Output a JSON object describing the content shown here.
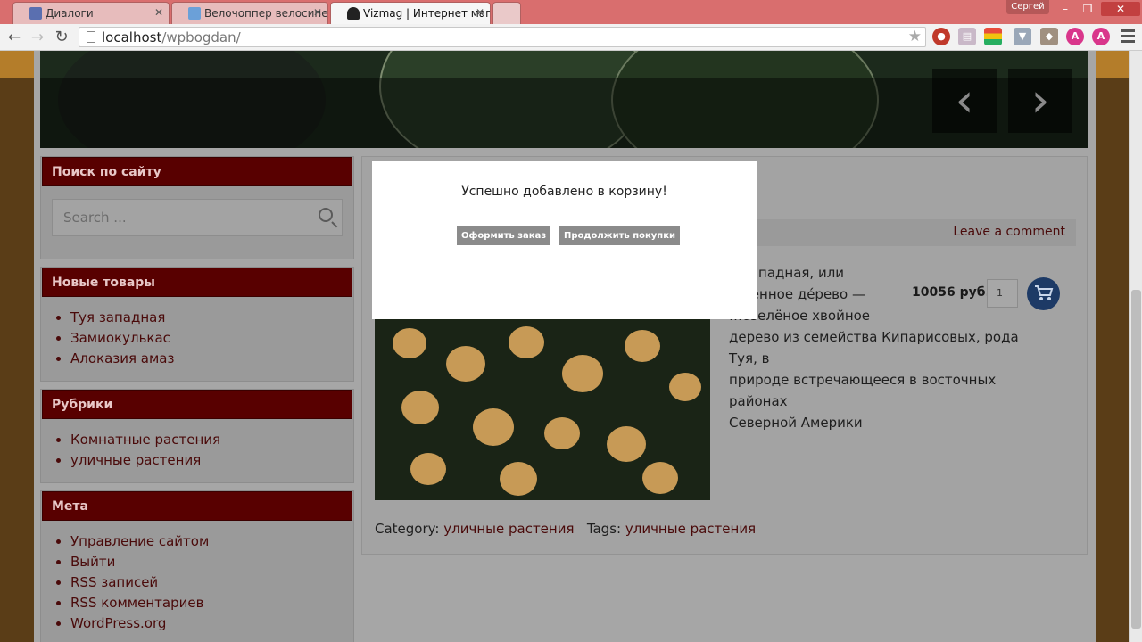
{
  "browser": {
    "tabs": [
      {
        "title": "Диалоги",
        "active": false
      },
      {
        "title": "Велочоппер велосипед д",
        "active": false
      },
      {
        "title": "Vizmag | Интернет магаз",
        "active": true
      }
    ],
    "user": "Сергей",
    "url_host": "localhost",
    "url_path": "/wpbogdan/",
    "colors": {
      "titlebar": "#d96e6e",
      "page_bg": "#5a3d17",
      "accent": "#580000"
    }
  },
  "sidebar": {
    "search": {
      "title": "Поиск по сайту",
      "placeholder": "Search ..."
    },
    "new_products": {
      "title": "Новые товары",
      "items": [
        "Туя западная",
        "Замиокулькас",
        "Алоказия амаз"
      ]
    },
    "categories": {
      "title": "Рубрики",
      "items": [
        "Комнатные растения",
        "уличные растения"
      ]
    },
    "meta": {
      "title": "Мета",
      "items": [
        "Управление сайтом",
        "Выйти",
        "RSS записей",
        "RSS комментариев",
        "WordPress.org"
      ]
    }
  },
  "product": {
    "leave_comment": "Leave a comment",
    "desc_lines": [
      "…ва́падная, или",
      "…нённое де́рево —",
      "…озелёное хвойное",
      "дерево из семейства Кипарисовых, рода Туя, в",
      "природе встречающееся в восточных районах",
      "Северной Америки"
    ],
    "price": "10056 руб.",
    "qty": "1",
    "category_label": "Category:",
    "category_value": "уличные растения",
    "tags_label": "Tags:",
    "tags_value": "уличные растения"
  },
  "modal": {
    "message": "Успешно добавлено в корзину!",
    "checkout_label": "Оформить заказ",
    "continue_label": "Продолжить покупки"
  }
}
